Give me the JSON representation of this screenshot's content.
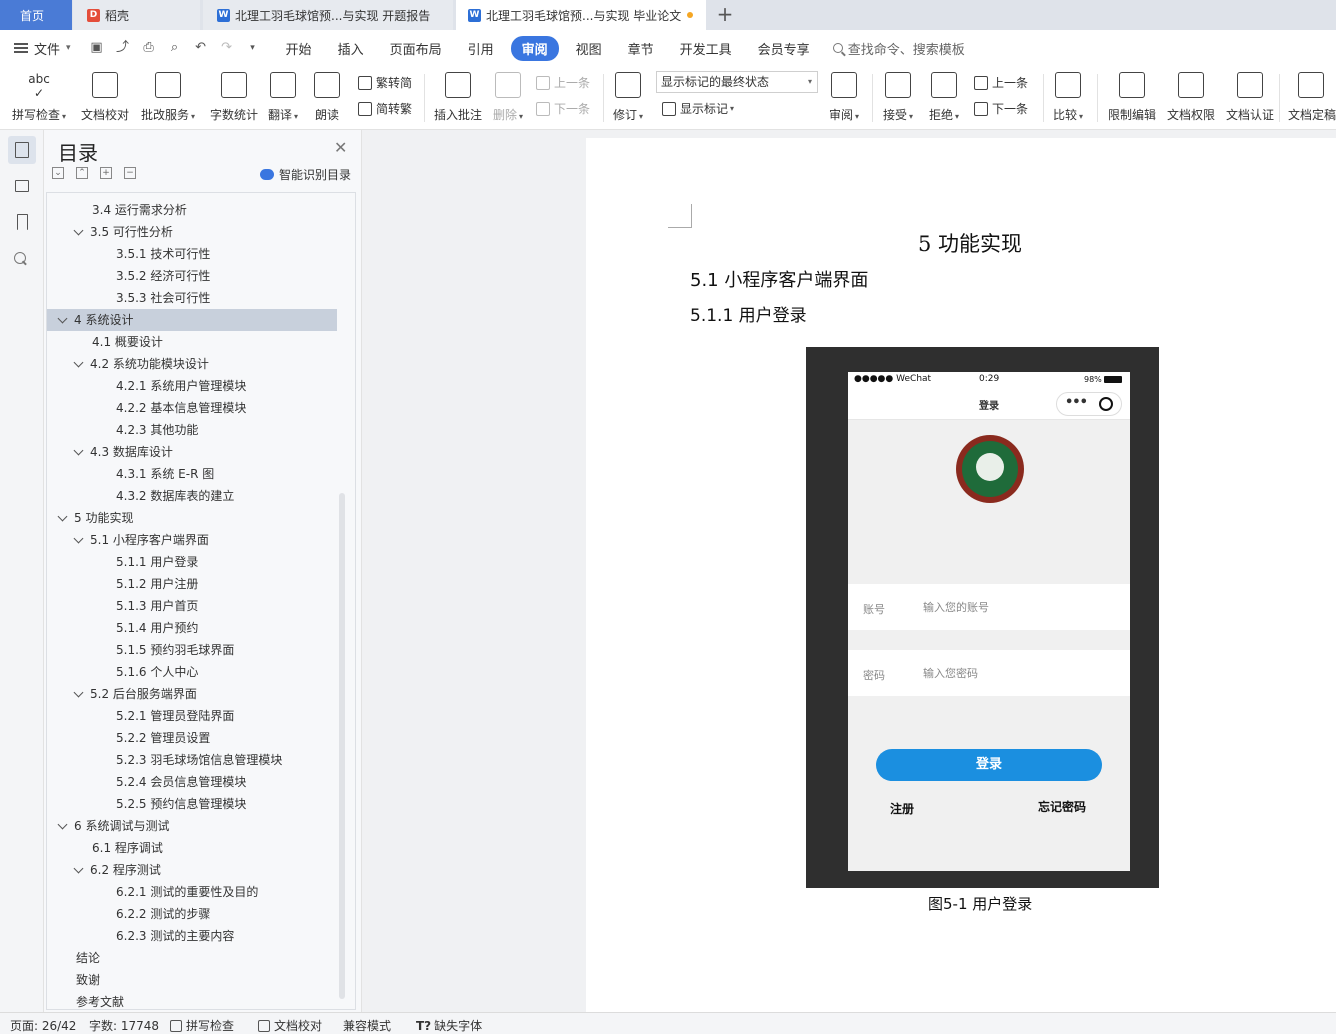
{
  "tabs": {
    "home": "首页",
    "daoke": "稻壳",
    "doc1": "北理工羽毛球馆预...与实现 开题报告",
    "doc2": "北理工羽毛球馆预...与实现 毕业论文"
  },
  "menu": {
    "file": "文件",
    "tabs": [
      "开始",
      "插入",
      "页面布局",
      "引用",
      "审阅",
      "视图",
      "章节",
      "开发工具",
      "会员专享"
    ],
    "active_tab": "审阅",
    "search": "查找命令、搜索模板"
  },
  "ribbon": {
    "spell": "拼写检查",
    "proof": "文档校对",
    "review_service": "批改服务",
    "word_count": "字数统计",
    "translate": "翻译",
    "read": "朗读",
    "trad": "繁转简",
    "simp": "简转繁",
    "insert_comment": "插入批注",
    "delete": "删除",
    "prev1": "上一条",
    "next1": "下一条",
    "track": "修订",
    "markup_select": "显示标记的最终状态",
    "show_markup": "显示标记",
    "review": "审阅",
    "accept": "接受",
    "reject": "拒绝",
    "prev2": "上一条",
    "next2": "下一条",
    "compare": "比较",
    "restrict": "限制编辑",
    "permission": "文档权限",
    "certify": "文档认证",
    "finalize": "文档定稿"
  },
  "toc": {
    "title": "目录",
    "smart": "智能识别目录",
    "items": [
      {
        "text": "3.4  运行需求分析",
        "level": 2,
        "chevron": false
      },
      {
        "text": "3.5  可行性分析",
        "level": 2,
        "chevron": true
      },
      {
        "text": "3.5.1 技术可行性",
        "level": 3,
        "chevron": false
      },
      {
        "text": "3.5.2 经济可行性",
        "level": 3,
        "chevron": false
      },
      {
        "text": "3.5.3 社会可行性",
        "level": 3,
        "chevron": false
      },
      {
        "text": "4  系统设计",
        "level": 1,
        "chevron": true,
        "selected": true
      },
      {
        "text": "4.1  概要设计",
        "level": 2,
        "chevron": false
      },
      {
        "text": "4.2  系统功能模块设计",
        "level": 2,
        "chevron": true
      },
      {
        "text": "4.2.1  系统用户管理模块",
        "level": 3,
        "chevron": false
      },
      {
        "text": "4.2.2  基本信息管理模块",
        "level": 3,
        "chevron": false
      },
      {
        "text": "4.2.3  其他功能",
        "level": 3,
        "chevron": false
      },
      {
        "text": "4.3  数据库设计",
        "level": 2,
        "chevron": true
      },
      {
        "text": "4.3.1  系统 E-R 图",
        "level": 3,
        "chevron": false
      },
      {
        "text": "4.3.2  数据库表的建立",
        "level": 3,
        "chevron": false
      },
      {
        "text": "5  功能实现",
        "level": 1,
        "chevron": true
      },
      {
        "text": "5.1  小程序客户端界面",
        "level": 2,
        "chevron": true
      },
      {
        "text": "5.1.1 用户登录",
        "level": 3,
        "chevron": false
      },
      {
        "text": "5.1.2  用户注册",
        "level": 3,
        "chevron": false
      },
      {
        "text": "5.1.3  用户首页",
        "level": 3,
        "chevron": false
      },
      {
        "text": "5.1.4  用户预约",
        "level": 3,
        "chevron": false
      },
      {
        "text": "5.1.5  预约羽毛球界面",
        "level": 3,
        "chevron": false
      },
      {
        "text": "5.1.6  个人中心",
        "level": 3,
        "chevron": false
      },
      {
        "text": "5.2  后台服务端界面",
        "level": 2,
        "chevron": true
      },
      {
        "text": "5.2.1  管理员登陆界面",
        "level": 3,
        "chevron": false
      },
      {
        "text": "5.2.2  管理员设置",
        "level": 3,
        "chevron": false
      },
      {
        "text": "5.2.3  羽毛球场馆信息管理模块",
        "level": 3,
        "chevron": false
      },
      {
        "text": "5.2.4  会员信息管理模块",
        "level": 3,
        "chevron": false
      },
      {
        "text": "5.2.5  预约信息管理模块",
        "level": 3,
        "chevron": false
      },
      {
        "text": "6  系统调试与测试",
        "level": 1,
        "chevron": true
      },
      {
        "text": "6.1  程序调试",
        "level": 2,
        "chevron": false
      },
      {
        "text": "6.2  程序测试",
        "level": 2,
        "chevron": true
      },
      {
        "text": "6.2.1  测试的重要性及目的",
        "level": 3,
        "chevron": false
      },
      {
        "text": "6.2.2  测试的步骤",
        "level": 3,
        "chevron": false
      },
      {
        "text": "6.2.3  测试的主要内容",
        "level": 3,
        "chevron": false
      },
      {
        "text": "结论",
        "level": 1,
        "chevron": false
      },
      {
        "text": "致谢",
        "level": 1,
        "chevron": false
      },
      {
        "text": "参考文献",
        "level": 1,
        "chevron": false
      }
    ]
  },
  "doc": {
    "h1": "5  功能实现",
    "h2": "5.1  小程序客户端界面",
    "h3": "5.1.1 用户登录",
    "caption": "图5-1  用户登录"
  },
  "phone": {
    "carrier": "●●●●● WeChat",
    "time": "0:29",
    "battery": "98%",
    "nav_title": "登录",
    "account_label": "账号",
    "account_placeholder": "输入您的账号",
    "password_label": "密码",
    "password_placeholder": "输入您密码",
    "login_button": "登录",
    "register": "注册",
    "forgot": "忘记密码"
  },
  "status": {
    "page": "页面: 26/42",
    "words": "字数: 17748",
    "spell": "拼写检查",
    "proof": "文档校对",
    "compat": "兼容模式",
    "missing_font": "缺失字体"
  },
  "colors": {
    "accent": "#3a76e0",
    "home_tab": "#4a7bd6",
    "login_button": "#1b8fe0",
    "unsaved_dot": "#f5a623"
  }
}
